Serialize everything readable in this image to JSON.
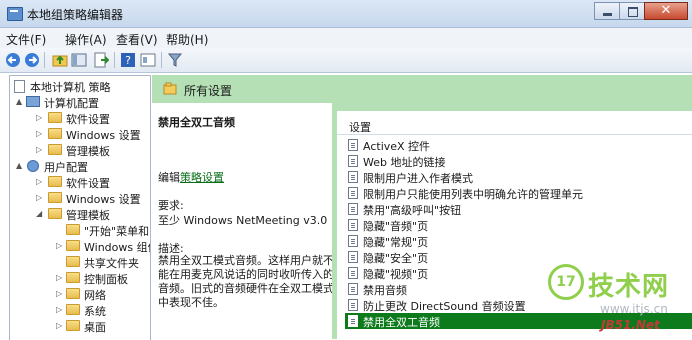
{
  "window": {
    "title": "本地组策略编辑器"
  },
  "menu": [
    "文件(F)",
    "操作(A)",
    "查看(V)",
    "帮助(H)"
  ],
  "toolbar": {
    "icons": [
      "back-arrow-icon",
      "forward-arrow-icon",
      "up-folder-icon",
      "show-hide-tree-icon",
      "export-list-icon",
      "help-icon",
      "properties-icon",
      "filter-icon"
    ]
  },
  "tree": [
    {
      "label": "本地计算机 策略",
      "level": 0,
      "icon": "doc",
      "expander": ""
    },
    {
      "label": "计算机配置",
      "level": 1,
      "icon": "computer",
      "expander": "▲"
    },
    {
      "label": "软件设置",
      "level": 2,
      "icon": "folder",
      "expander": "▷"
    },
    {
      "label": "Windows 设置",
      "level": 2,
      "icon": "folder",
      "expander": "▷"
    },
    {
      "label": "管理模板",
      "level": 2,
      "icon": "folder",
      "expander": "▷"
    },
    {
      "label": "用户配置",
      "level": 1,
      "icon": "user",
      "expander": "▲"
    },
    {
      "label": "软件设置",
      "level": 2,
      "icon": "folder",
      "expander": "▷"
    },
    {
      "label": "Windows 设置",
      "level": 2,
      "icon": "folder",
      "expander": "▷"
    },
    {
      "label": "管理模板",
      "level": 2,
      "icon": "folder",
      "expander": "◢"
    },
    {
      "label": "\"开始\"菜单和",
      "level": 3,
      "icon": "folder",
      "expander": ""
    },
    {
      "label": "Windows 组件",
      "level": 3,
      "icon": "folder",
      "expander": "▷"
    },
    {
      "label": "共享文件夹",
      "level": 3,
      "icon": "folder",
      "expander": ""
    },
    {
      "label": "控制面板",
      "level": 3,
      "icon": "folder",
      "expander": "▷"
    },
    {
      "label": "网络",
      "level": 3,
      "icon": "folder",
      "expander": "▷"
    },
    {
      "label": "系统",
      "level": 3,
      "icon": "folder",
      "expander": "▷"
    },
    {
      "label": "桌面",
      "level": 3,
      "icon": "folder",
      "expander": "▷"
    }
  ],
  "main": {
    "header_title": "所有设置",
    "policy_title": "禁用全双工音频",
    "edit_prefix": "编辑",
    "edit_link": "策略设置",
    "requirements_label": "要求:",
    "requirements_text": "至少 Windows NetMeeting v3.0",
    "description_label": "描述:",
    "description_text": "禁用全双工模式音频。这样用户就不能在用麦克风说话的同时收听传入的音频。旧式的音频硬件在全双工模式中表现不佳。"
  },
  "list": {
    "column_header": "设置",
    "items": [
      "ActiveX 控件",
      "Web 地址的链接",
      "限制用户进入作者模式",
      "限制用户只能使用列表中明确允许的管理单元",
      "禁用\"高级呼叫\"按钮",
      "隐藏\"音频\"页",
      "隐藏\"常规\"页",
      "隐藏\"安全\"页",
      "隐藏\"视频\"页",
      "禁用音频",
      "防止更改 DirectSound 音频设置",
      "禁用全双工音频"
    ],
    "selected_index": 11
  },
  "watermark": {
    "logo_num": "17",
    "brand": "技术网",
    "url": "www.itjs.cn",
    "site": "JB51.Net"
  },
  "colors": {
    "accent_green": "#b5dfb4",
    "selected_row": "#0d7a1c",
    "link": "#0b6e19"
  }
}
